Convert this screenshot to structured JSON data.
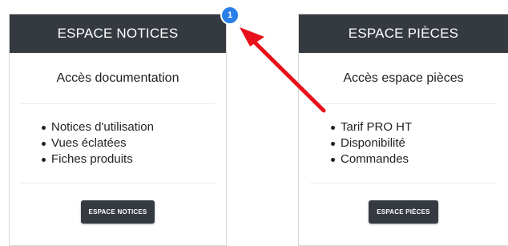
{
  "badge": {
    "number": "1",
    "color": "#2a80e8"
  },
  "cards": [
    {
      "header": "ESPACE NOTICES",
      "subtitle": "Accès documentation",
      "features": [
        "Notices d'utilisation",
        "Vues éclatées",
        "Fiches produits"
      ],
      "button_label": "ESPACE NOTICES"
    },
    {
      "header": "ESPACE PIÈCES",
      "subtitle": "Accès espace pièces",
      "features": [
        "Tarif PRO HT",
        "Disponibilité",
        "Commandes"
      ],
      "button_label": "ESPACE PIÈCES"
    }
  ],
  "colors": {
    "header_bg": "#343a40",
    "arrow": "#e8111b"
  }
}
